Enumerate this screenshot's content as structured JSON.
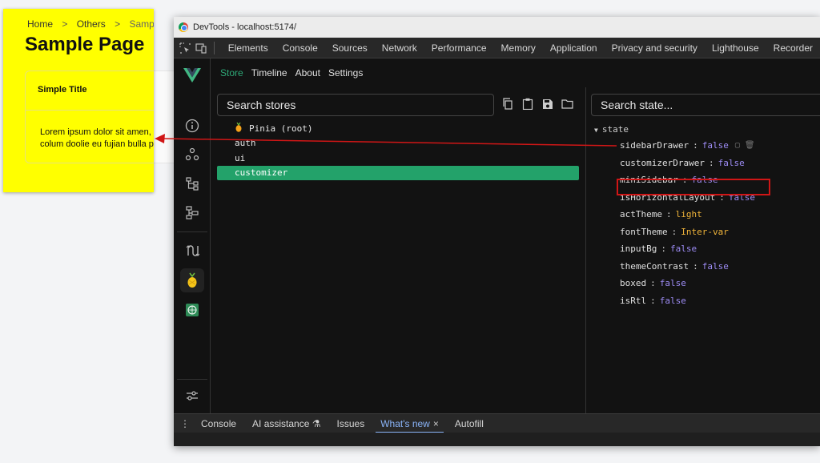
{
  "app": {
    "breadcrumb": [
      "Home",
      "Others",
      "Sample Page"
    ],
    "breadcrumb_sep": ">",
    "page_title": "Sample Page",
    "card_title": "Simple Title",
    "card_body_line1": "Lorem ipsum dolor sit amen, con",
    "card_body_line2": "colum doolie eu fujian bulla pari"
  },
  "window": {
    "title": "DevTools - localhost:5174/"
  },
  "devtools_tabs": [
    "Elements",
    "Console",
    "Sources",
    "Network",
    "Performance",
    "Memory",
    "Application",
    "Privacy and security",
    "Lighthouse",
    "Recorder"
  ],
  "vue_nav": [
    "Store",
    "Timeline",
    "About",
    "Settings"
  ],
  "stores": {
    "search_placeholder": "Search stores",
    "items": [
      {
        "label": "Pinia (root)",
        "icon": "pineapple-icon"
      },
      {
        "label": "auth"
      },
      {
        "label": "ui"
      },
      {
        "label": "customizer",
        "selected": true
      }
    ]
  },
  "state": {
    "search_placeholder": "Search state...",
    "root_label": "state",
    "rows": [
      {
        "key": "sidebarDrawer",
        "value": "false",
        "type": "bool"
      },
      {
        "key": "customizerDrawer",
        "value": "false",
        "type": "bool"
      },
      {
        "key": "miniSidebar",
        "value": "false",
        "type": "bool"
      },
      {
        "key": "isHorizontalLayout",
        "value": "false",
        "type": "bool"
      },
      {
        "key": "actTheme",
        "value": "light",
        "type": "str"
      },
      {
        "key": "fontTheme",
        "value": "Inter-var",
        "type": "str"
      },
      {
        "key": "inputBg",
        "value": "false",
        "type": "bool"
      },
      {
        "key": "themeContrast",
        "value": "false",
        "type": "bool"
      },
      {
        "key": "boxed",
        "value": "false",
        "type": "bool"
      },
      {
        "key": "isRtl",
        "value": "false",
        "type": "bool"
      }
    ]
  },
  "drawer": {
    "tabs": [
      "Console",
      "AI assistance",
      "Issues",
      "What's new",
      "Autofill"
    ],
    "active": "What's new",
    "close_glyph": "×"
  },
  "colors": {
    "accent_green": "#23a26a",
    "highlight_red": "#d01616",
    "page_yellow": "#ffff00"
  }
}
